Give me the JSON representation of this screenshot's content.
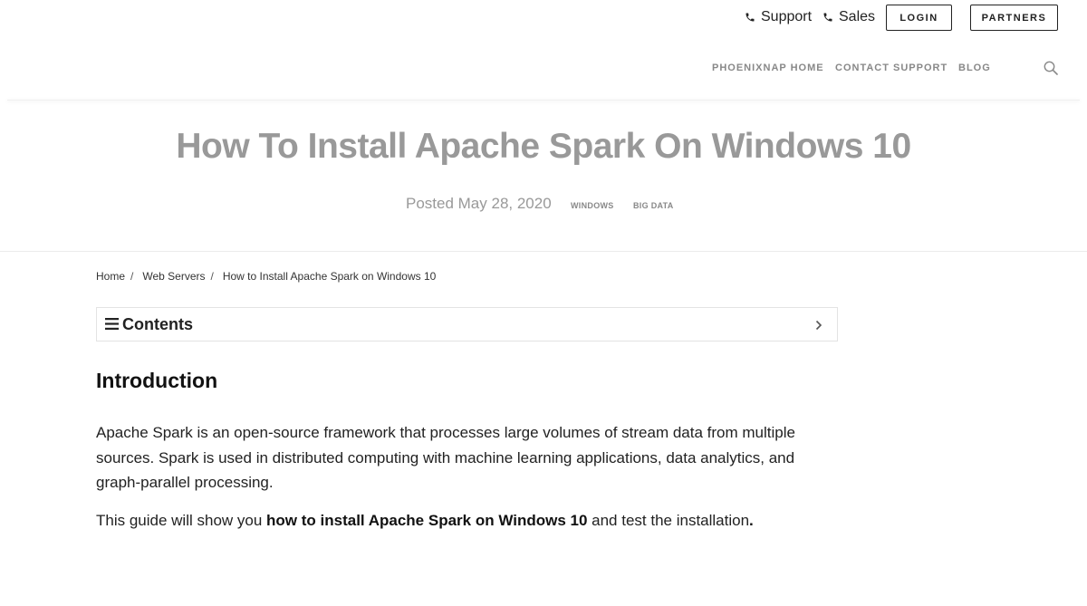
{
  "topbar": {
    "support_label": "Support",
    "sales_label": "Sales",
    "login_label": "LOGIN",
    "partners_label": "PARTNERS"
  },
  "nav": {
    "home_label": "PHOENIXNAP HOME",
    "contact_label": "CONTACT SUPPORT",
    "blog_label": "BLOG",
    "search_icon": "search-icon"
  },
  "hero": {
    "title": "How To Install Apache Spark On Windows 10",
    "posted": "Posted May 28, 2020",
    "tags": [
      "WINDOWS",
      "BIG DATA"
    ]
  },
  "breadcrumb": {
    "items": [
      "Home",
      "Web Servers",
      "How to Install Apache Spark on Windows 10"
    ],
    "separator": "/"
  },
  "contents": {
    "label": "Contents",
    "icon": "menu-icon",
    "chevron": "chevron-right-icon"
  },
  "article": {
    "heading": "Introduction",
    "paragraph1": "Apache Spark is an open-source framework that processes large volumes of stream data from multiple sources. Spark is used in distributed computing with machine learning applications, data analytics, and graph-parallel processing.",
    "paragraph2_pre": "This guide will show you ",
    "paragraph2_bold": "how to install Apache Spark on Windows 10",
    "paragraph2_post": " and test the installation",
    "paragraph2_end": "."
  },
  "colors": {
    "title_gray": "#999999",
    "nav_gray": "#888888",
    "text": "#222222"
  }
}
